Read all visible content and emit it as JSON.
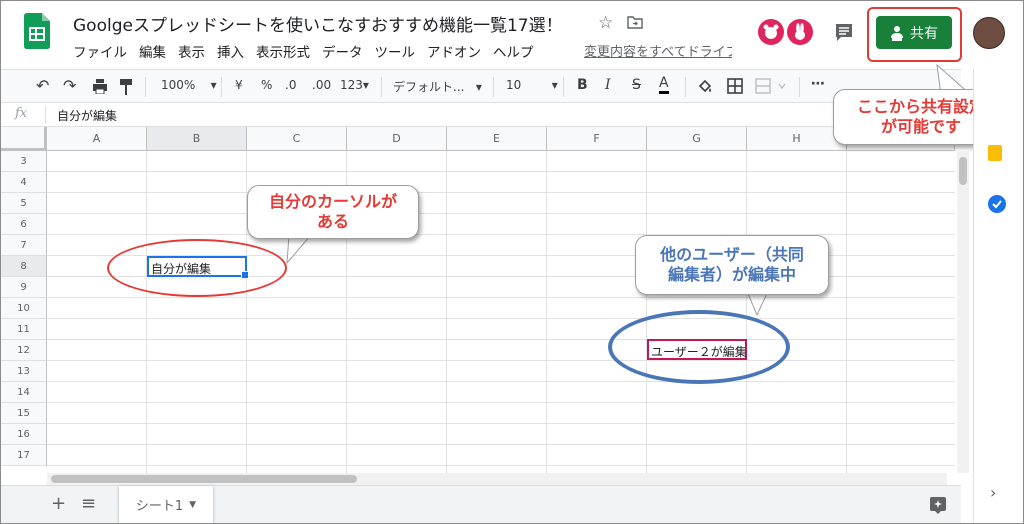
{
  "app": {
    "doc_title": "Goolgeスプレッドシートを使いこなすおすすめ機能一覧17選！",
    "last_edit_link": "変更内容をすべてドライブに保存しました",
    "share_label": "共有",
    "menu": [
      "ファイル",
      "編集",
      "表示",
      "挿入",
      "表示形式",
      "データ",
      "ツール",
      "アドオン",
      "ヘルプ"
    ]
  },
  "toolbar": {
    "zoom": "100%",
    "currency": "¥",
    "percent": "%",
    "dec_less": ".0",
    "dec_more": ".00",
    "format_more": "123",
    "font": "デフォルト...",
    "font_size": "10",
    "bold": "B",
    "italic": "I",
    "strike": "S",
    "text_color": "A",
    "more": "⋯"
  },
  "formula_bar": {
    "fx_label": "fx",
    "value": "自分が編集"
  },
  "grid": {
    "columns": [
      "A",
      "B",
      "C",
      "D",
      "E",
      "F",
      "G",
      "H"
    ],
    "rows": [
      "3",
      "4",
      "5",
      "6",
      "7",
      "8",
      "9",
      "10",
      "11",
      "12",
      "13",
      "14",
      "15",
      "16",
      "17"
    ],
    "cell_b8": "自分が編集",
    "cell_g12": "ユーザー２が編集"
  },
  "annotations": {
    "own_cursor_line1": "自分のカーソルが",
    "own_cursor_line2": "ある",
    "other_user_line1": "他のユーザー（共同",
    "other_user_line2": "編集者）が編集中",
    "share_hint_line1": "ここから共有設定",
    "share_hint_line2": "が可能です",
    "red_color": "#e53935",
    "blue_color": "#4a76b8"
  },
  "sheets": {
    "add": "+",
    "list": "≡",
    "active_tab": "シート1"
  }
}
